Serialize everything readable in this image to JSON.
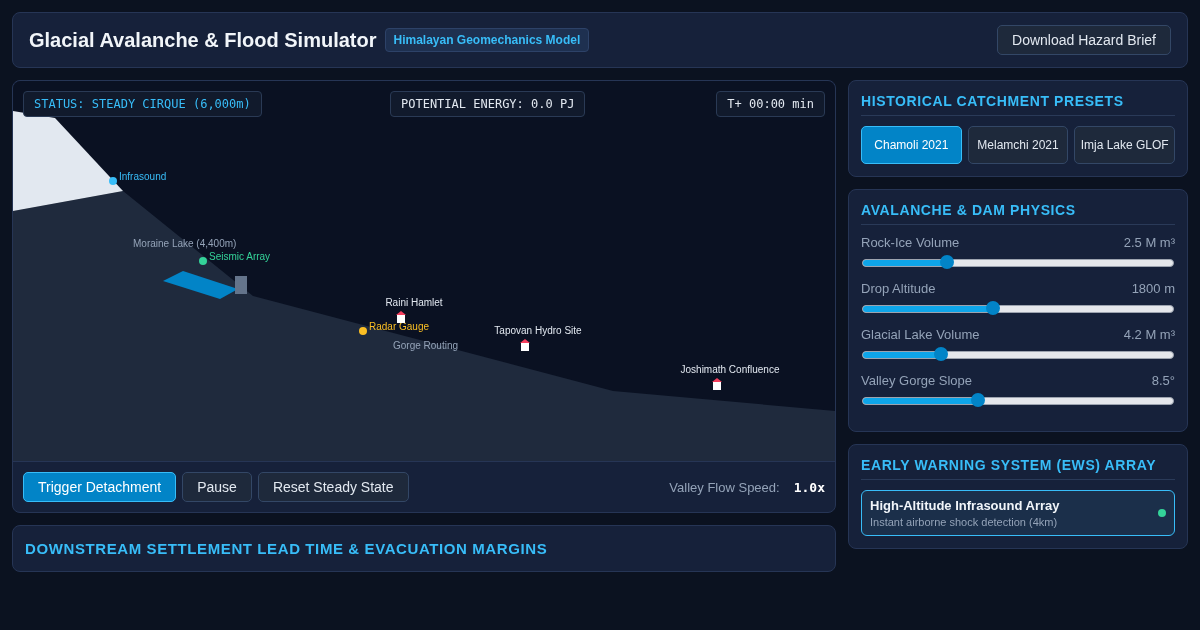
{
  "header": {
    "title": "Glacial Avalanche & Flood Simulator",
    "badge": "Himalayan Geomechanics Model",
    "button": "Download Hazard Brief"
  },
  "scene": {
    "status": "STATUS: STEADY CIRQUE (6,000m)",
    "energy": "POTENTIAL ENERGY: 0.0 PJ",
    "time": "T+ 00:00 min",
    "lake_label": "Moraine Lake (4,400m)",
    "routing_label": "Gorge Routing",
    "sensors": [
      {
        "label": "Infrasound",
        "color": "#38bdf8"
      },
      {
        "label": "Seismic Array",
        "color": "#34d399"
      },
      {
        "label": "Radar Gauge",
        "color": "#fbbf24"
      }
    ],
    "settlements": [
      {
        "label": "Raini Hamlet"
      },
      {
        "label": "Tapovan Hydro Site"
      },
      {
        "label": "Joshimath Confluence"
      }
    ]
  },
  "controls": {
    "buttons": [
      {
        "label": "Trigger Detachment",
        "selected": true
      },
      {
        "label": "Pause",
        "selected": false
      },
      {
        "label": "Reset Steady State",
        "selected": false
      }
    ],
    "speed_label": "Valley Flow Speed:",
    "speed_value": "1.0x"
  },
  "downstream": {
    "title": "DOWNSTREAM SETTLEMENT LEAD TIME & EVACUATION MARGINS"
  },
  "presets": {
    "title": "HISTORICAL CATCHMENT PRESETS",
    "items": [
      {
        "label": "Chamoli 2021",
        "selected": true
      },
      {
        "label": "Melamchi 2021",
        "selected": false
      },
      {
        "label": "Imja Lake GLOF",
        "selected": false
      }
    ]
  },
  "physics": {
    "title": "AVALANCHE & DAM PHYSICS",
    "sliders": [
      {
        "label": "Rock-Ice Volume",
        "reading": "2.5 M m³",
        "level": 0.27
      },
      {
        "label": "Drop Altitude",
        "reading": "1800 m",
        "level": 0.42
      },
      {
        "label": "Glacial Lake Volume",
        "reading": "4.2 M m³",
        "level": 0.25
      },
      {
        "label": "Valley Gorge Slope",
        "reading": "8.5°",
        "level": 0.37
      }
    ]
  },
  "ews": {
    "title": "EARLY WARNING SYSTEM (EWS) ARRAY",
    "items": [
      {
        "name": "High-Altitude Infrasound Array",
        "detail": "Instant airborne shock detection (4km)",
        "on": true
      }
    ]
  }
}
